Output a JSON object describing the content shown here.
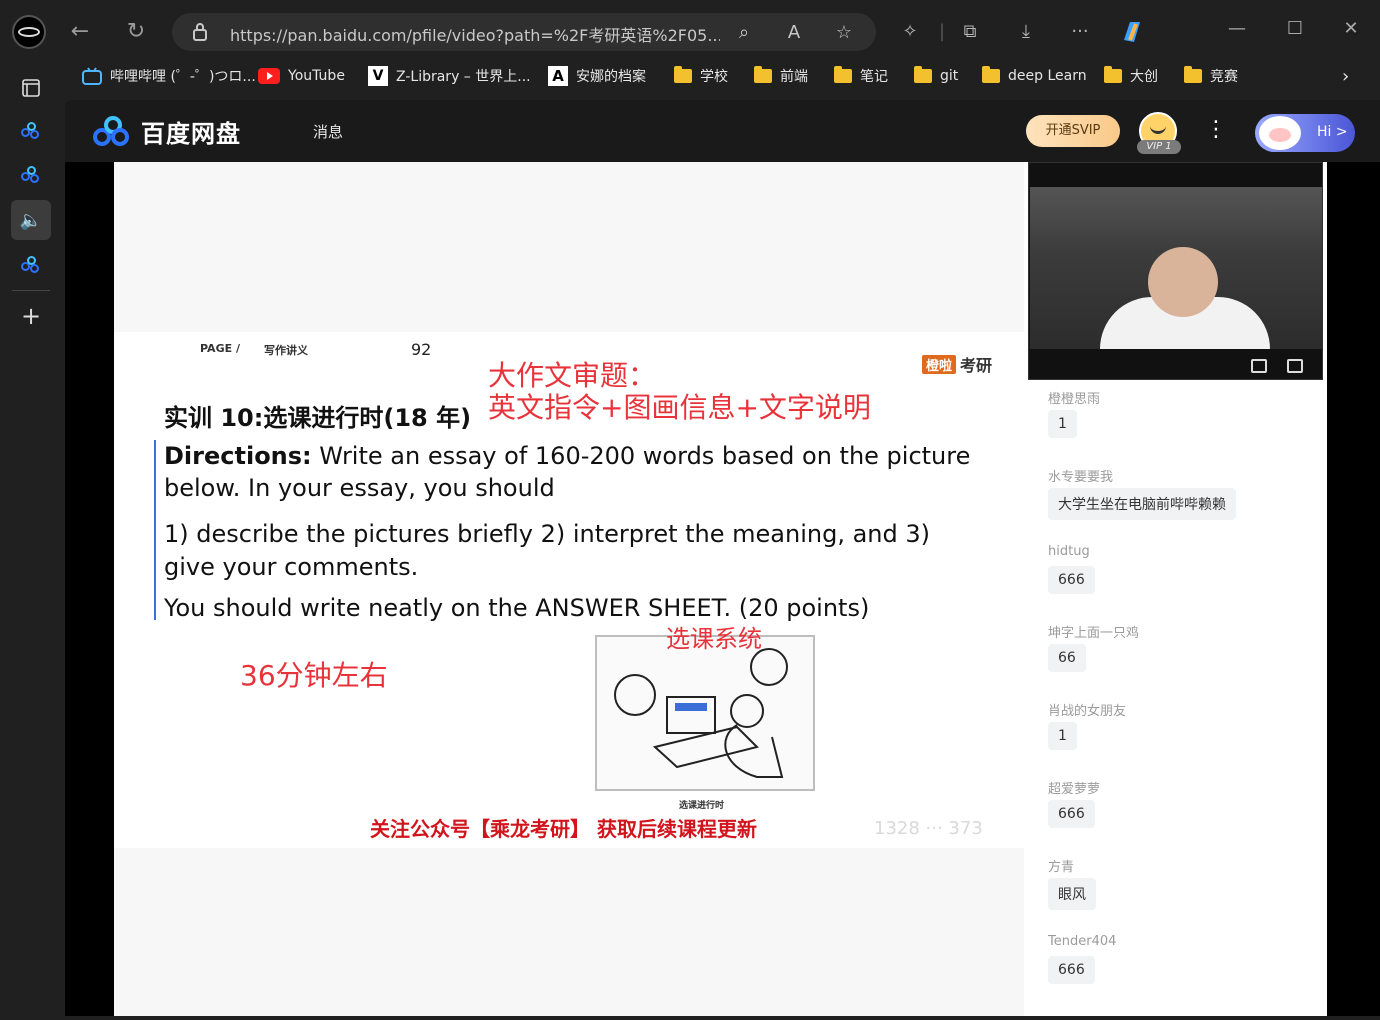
{
  "browser": {
    "url": "https://pan.baidu.com/pfile/video?path=%2F考研英语%2F05....",
    "bookmarks": [
      {
        "label": "哔哩哔哩 (゜-゜)つロ...",
        "icon": "bilibili-icon"
      },
      {
        "label": "YouTube",
        "icon": "youtube-icon"
      },
      {
        "label": "Z-Library – 世界上...",
        "icon": "zlibrary-icon"
      },
      {
        "label": "安娜的档案",
        "icon": "annas-archive-icon"
      },
      {
        "label": "学校",
        "icon": "folder-icon"
      },
      {
        "label": "前端",
        "icon": "folder-icon"
      },
      {
        "label": "笔记",
        "icon": "folder-icon"
      },
      {
        "label": "git",
        "icon": "folder-icon"
      },
      {
        "label": "deep Learn",
        "icon": "folder-icon"
      },
      {
        "label": "大创",
        "icon": "folder-icon"
      },
      {
        "label": "竞赛",
        "icon": "folder-icon"
      }
    ]
  },
  "app": {
    "logo_text": "百度网盘",
    "nav_message": "消息",
    "svip_label": "开通SVIP",
    "vip_badge": "VIP 1",
    "hi_label": "Hi >"
  },
  "slide": {
    "page_head_left": "PAGE /",
    "page_head_mid": "写作讲义",
    "page_number": "92",
    "brand_tag": "橙啦",
    "brand_text": "考研",
    "annotation_title": "大作文审题：",
    "annotation_sub": "英文指令+图画信息+文字说明",
    "section_title": "实训 10:选课进行时(18 年)",
    "directions_label": "Directions:",
    "directions_text": " Write an essay of 160-200 words based on the picture below. In your essay, you should",
    "items_text": "1) describe the pictures briefly 2) interpret the meaning, and 3) give your comments.",
    "sheet_text": "You should write neatly on the ANSWER SHEET. (20 points)",
    "time_note": "36分钟左右",
    "cartoon_label": "选课系统",
    "cartoon_caption": "选课进行时",
    "footer_promo": "关注公众号【乘龙考研】 获取后续课程更新",
    "watermark": "1328 ··· 373"
  },
  "chat": [
    {
      "user": "橙橙思雨",
      "msg": "1"
    },
    {
      "user": "水专要要我",
      "msg": "大学生坐在电脑前哔哔赖赖"
    },
    {
      "user": "hidtug",
      "msg": "666"
    },
    {
      "user": "坤字上面一只鸡",
      "msg": "66"
    },
    {
      "user": "肖战的女朋友",
      "msg": "1"
    },
    {
      "user": "超爱萝萝",
      "msg": "666"
    },
    {
      "user": "方青",
      "msg": "眼风"
    },
    {
      "user": "Tender404",
      "msg": "666"
    }
  ],
  "colors": {
    "accent_red": "#e8333b",
    "underline_blue": "#3b6ed6",
    "svip_gold": "#f9c989",
    "folder_yellow": "#f3c12d"
  }
}
